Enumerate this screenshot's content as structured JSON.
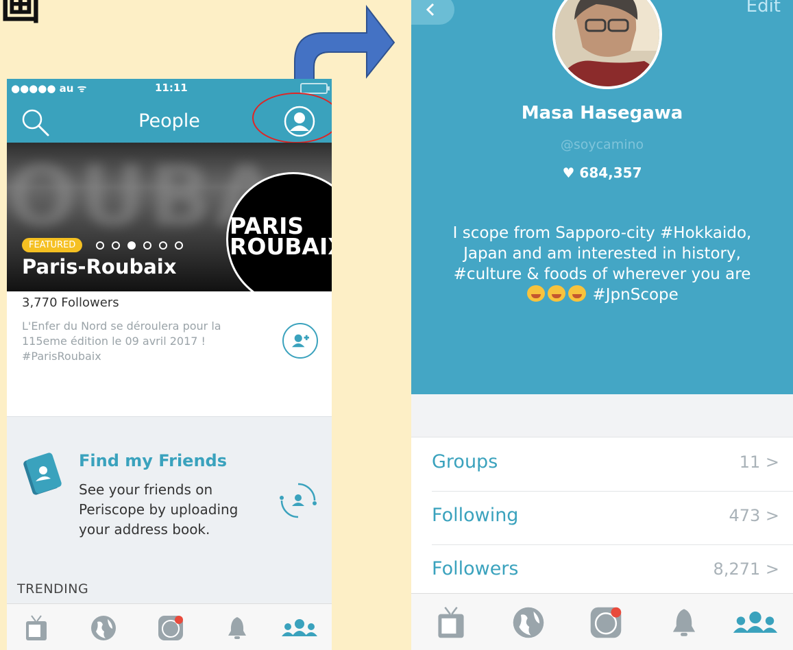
{
  "corner_title": "画",
  "left_screen": {
    "status": {
      "carrier": "●●●●● au ᯤ",
      "time": "11:11"
    },
    "header": {
      "title": "People"
    },
    "featured": {
      "badge": "FEATURED",
      "name": "Paris-Roubaix",
      "logo_line1": "PARIS",
      "logo_line2": "ROUBAIX",
      "blurred_text": "OUBA",
      "followers": "3,770 Followers",
      "description": "L'Enfer du Nord se déroulera pour la 115eme édition le 09 avril 2017 ! #ParisRoubaix"
    },
    "find_friends": {
      "title": "Find my Friends",
      "description": "See your friends on Periscope by uploading your address book."
    },
    "trending_label": "TRENDING",
    "tabs": [
      "tv-icon",
      "globe-icon",
      "camera-icon",
      "bell-icon",
      "people-icon"
    ],
    "active_tab": "people-icon"
  },
  "right_screen": {
    "edit_label": "Edit",
    "profile": {
      "name": "Masa Hasegawa",
      "handle": "@soycamino",
      "hearts": "684,357",
      "bio_text": "I scope from Sapporo-city #Hokkaido, Japan and am interested in history, #culture & foods of wherever you are",
      "bio_tag": "#JpnScope"
    },
    "rows": [
      {
        "label": "Groups",
        "value": "11 >"
      },
      {
        "label": "Following",
        "value": "473 >"
      },
      {
        "label": "Followers",
        "value": "8,271 >"
      }
    ],
    "tabs": [
      "tv-icon",
      "globe-icon",
      "camera-icon",
      "bell-icon",
      "people-icon"
    ],
    "active_tab": "people-icon"
  },
  "colors": {
    "background": "#fdefc6",
    "accent": "#3aa2bd",
    "profile_bg": "#44a6c5",
    "highlight_circle": "#e02424",
    "arrow": "#4472c4",
    "featured_badge": "#f5c022"
  }
}
